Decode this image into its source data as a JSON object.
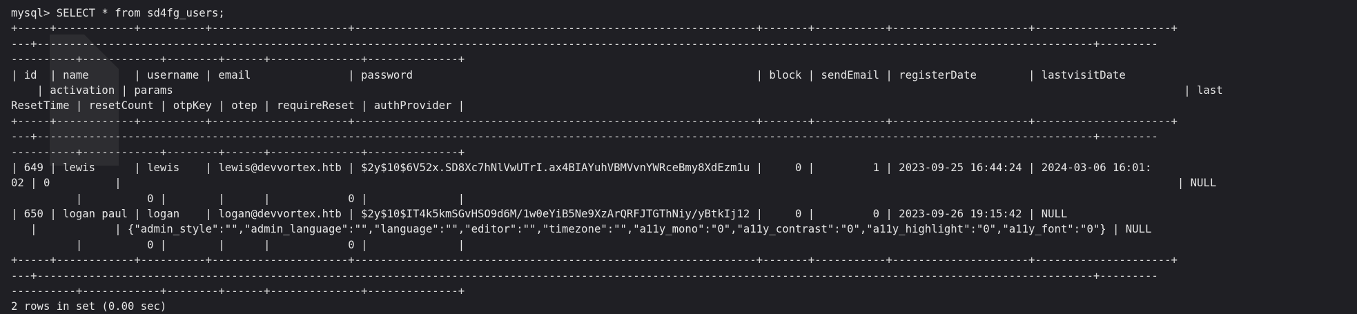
{
  "terminal": {
    "prompt": "mysql> SELECT * from sd4fg_users;",
    "lines": [
      "+-----+------------+----------+---------------------+--------------------------------------------------------------+-------+-----------+---------------------+---------------------+",
      "---+-------------------------------------------------------------------------------------------------------------------------------------------------------------------+---------",
      "----------+------------+--------+------+--------------+--------------+",
      "| id  | name       | username | email               | password                                                     | block | sendEmail | registerDate        | lastvisitDate",
      "    | activation | params                                                                                                                                                            | last",
      "ResetTime | resetCount | otpKey | otep | requireReset | authProvider |",
      "+-----+------------+----------+---------------------+--------------------------------------------------------------+-------+-----------+---------------------+---------------------+",
      "---+-------------------------------------------------------------------------------------------------------------------------------------------------------------------+---------",
      "----------+------------+--------+------+--------------+--------------+",
      "| 649 | lewis      | lewis    | lewis@devvortex.htb | $2y$10$6V52x.SD8Xc7hNlVwUTrI.ax4BIAYuhVBMVvnYWRceBmy8XdEzm1u |     0 |         1 | 2023-09-25 16:44:24 | 2024-03-06 16:01:",
      "02 | 0          |                                                                                                                                                                   | NULL",
      "          |          0 |        |      |            0 |              |",
      "| 650 | logan paul | logan    | logan@devvortex.htb | $2y$10$IT4k5kmSGvHSO9d6M/1w0eYiB5Ne9XzArQRFJTGThNiy/yBtkIj12 |     0 |         0 | 2023-09-26 19:15:42 | NULL",
      "   |            | {\"admin_style\":\"\",\"admin_language\":\"\",\"language\":\"\",\"editor\":\"\",\"timezone\":\"\",\"a11y_mono\":\"0\",\"a11y_contrast\":\"0\",\"a11y_highlight\":\"0\",\"a11y_font\":\"0\"} | NULL",
      "          |          0 |        |      |            0 |              |",
      "+-----+------------+----------+---------------------+--------------------------------------------------------------+-------+-----------+---------------------+---------------------+",
      "---+-------------------------------------------------------------------------------------------------------------------------------------------------------------------+---------",
      "----------+------------+--------+------+--------------+--------------+",
      "2 rows in set (0.00 sec)"
    ]
  }
}
